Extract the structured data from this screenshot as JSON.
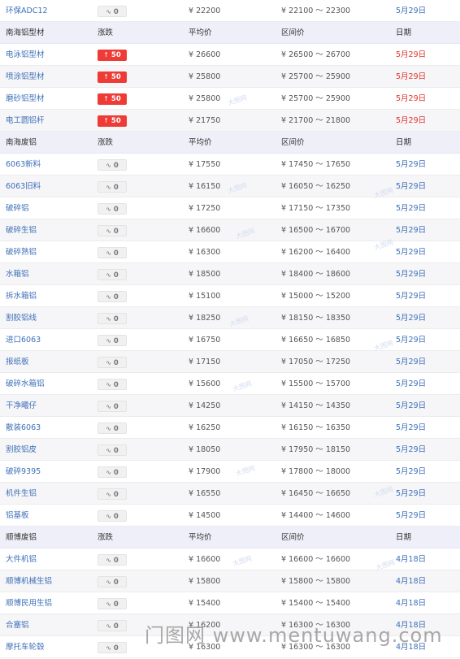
{
  "currency": "¥",
  "range_sep": "～",
  "header_labels": {
    "change": "涨跌",
    "avg": "平均价",
    "range": "区间价",
    "date": "日期"
  },
  "rows": [
    {
      "type": "item",
      "name": "环保ADC12",
      "sup": "",
      "change": "0",
      "dir": "flat",
      "avg": "22200",
      "low": "22100",
      "high": "22300",
      "date": "5月29日",
      "date_color": "blue"
    },
    {
      "type": "header",
      "name": "南海铝型材"
    },
    {
      "type": "item",
      "name": "电泳铝型材",
      "change": "50",
      "dir": "up",
      "avg": "26600",
      "low": "26500",
      "high": "26700",
      "date": "5月29日",
      "date_color": "red"
    },
    {
      "type": "item",
      "name": "喷涂铝型材",
      "change": "50",
      "dir": "up",
      "avg": "25800",
      "low": "25700",
      "high": "25900",
      "date": "5月29日",
      "date_color": "red"
    },
    {
      "type": "item",
      "name": "磨砂铝型材",
      "change": "50",
      "dir": "up",
      "avg": "25800",
      "low": "25700",
      "high": "25900",
      "date": "5月29日",
      "date_color": "red"
    },
    {
      "type": "item",
      "name": "电工圆铝杆",
      "change": "50",
      "dir": "up",
      "avg": "21750",
      "low": "21700",
      "high": "21800",
      "date": "5月29日",
      "date_color": "red"
    },
    {
      "type": "header",
      "name": "南海废铝"
    },
    {
      "type": "item",
      "name": "6063新料",
      "change": "0",
      "dir": "flat",
      "avg": "17550",
      "low": "17450",
      "high": "17650",
      "date": "5月29日",
      "date_color": "blue"
    },
    {
      "type": "item",
      "name": "6063旧料",
      "change": "0",
      "dir": "flat",
      "avg": "16150",
      "low": "16050",
      "high": "16250",
      "date": "5月29日",
      "date_color": "blue"
    },
    {
      "type": "item",
      "name": "破碎铝",
      "change": "0",
      "dir": "flat",
      "avg": "17250",
      "low": "17150",
      "high": "17350",
      "date": "5月29日",
      "date_color": "blue"
    },
    {
      "type": "item",
      "name": "破碎生铝",
      "change": "0",
      "dir": "flat",
      "avg": "16600",
      "low": "16500",
      "high": "16700",
      "date": "5月29日",
      "date_color": "blue"
    },
    {
      "type": "item",
      "name": "破碎熟铝",
      "change": "0",
      "dir": "flat",
      "avg": "16300",
      "low": "16200",
      "high": "16400",
      "date": "5月29日",
      "date_color": "blue"
    },
    {
      "type": "item",
      "name": "水箱铝",
      "change": "0",
      "dir": "flat",
      "avg": "18500",
      "low": "18400",
      "high": "18600",
      "date": "5月29日",
      "date_color": "blue"
    },
    {
      "type": "item",
      "name": "拆水箱铝",
      "change": "0",
      "dir": "flat",
      "avg": "15100",
      "low": "15000",
      "high": "15200",
      "date": "5月29日",
      "date_color": "blue"
    },
    {
      "type": "item",
      "name": "割胶铝线",
      "change": "0",
      "dir": "flat",
      "avg": "18250",
      "low": "18150",
      "high": "18350",
      "date": "5月29日",
      "date_color": "blue"
    },
    {
      "type": "item",
      "name": "进口6063",
      "change": "0",
      "dir": "flat",
      "avg": "16750",
      "low": "16650",
      "high": "16850",
      "date": "5月29日",
      "date_color": "blue"
    },
    {
      "type": "item",
      "name": "报纸板",
      "change": "0",
      "dir": "flat",
      "avg": "17150",
      "low": "17050",
      "high": "17250",
      "date": "5月29日",
      "date_color": "blue"
    },
    {
      "type": "item",
      "name": "破碎水箱铝",
      "change": "0",
      "dir": "flat",
      "avg": "15600",
      "low": "15500",
      "high": "15700",
      "date": "5月29日",
      "date_color": "blue"
    },
    {
      "type": "item",
      "name": "干净曦仔",
      "change": "0",
      "dir": "flat",
      "avg": "14250",
      "low": "14150",
      "high": "14350",
      "date": "5月29日",
      "date_color": "blue"
    },
    {
      "type": "item",
      "name": "散装6063",
      "change": "0",
      "dir": "flat",
      "avg": "16250",
      "low": "16150",
      "high": "16350",
      "date": "5月29日",
      "date_color": "blue"
    },
    {
      "type": "item",
      "name": "割胶铝皮",
      "change": "0",
      "dir": "flat",
      "avg": "18050",
      "low": "17950",
      "high": "18150",
      "date": "5月29日",
      "date_color": "blue"
    },
    {
      "type": "item",
      "name": "破碎9395",
      "change": "0",
      "dir": "flat",
      "avg": "17900",
      "low": "17800",
      "high": "18000",
      "date": "5月29日",
      "date_color": "blue"
    },
    {
      "type": "item",
      "name": "机件生铝",
      "change": "0",
      "dir": "flat",
      "avg": "16550",
      "low": "16450",
      "high": "16650",
      "date": "5月29日",
      "date_color": "blue"
    },
    {
      "type": "item",
      "name": "铝基板",
      "change": "0",
      "dir": "flat",
      "avg": "14500",
      "low": "14400",
      "high": "14600",
      "date": "5月29日",
      "date_color": "blue"
    },
    {
      "type": "header",
      "name": "顺博废铝"
    },
    {
      "type": "item",
      "name": "大件机铝",
      "change": "0",
      "dir": "flat",
      "avg": "16600",
      "low": "16600",
      "high": "16600",
      "date": "4月18日",
      "date_color": "blue"
    },
    {
      "type": "item",
      "name": "顺博机械生铝",
      "change": "0",
      "dir": "flat",
      "avg": "15800",
      "low": "15800",
      "high": "15800",
      "date": "4月18日",
      "date_color": "blue"
    },
    {
      "type": "item",
      "name": "顺博民用生铝",
      "change": "0",
      "dir": "flat",
      "avg": "15400",
      "low": "15400",
      "high": "15400",
      "date": "4月18日",
      "date_color": "blue"
    },
    {
      "type": "item",
      "name": "合塞铝",
      "change": "0",
      "dir": "flat",
      "avg": "16200",
      "low": "16300",
      "high": "16300",
      "date": "4月18日",
      "date_color": "blue"
    },
    {
      "type": "item",
      "name": "摩托车轮毂",
      "change": "0",
      "dir": "flat",
      "avg": "16300",
      "low": "16300",
      "high": "16300",
      "date": "4月18日",
      "date_color": "blue"
    }
  ],
  "watermark": {
    "text": "门图网 www.mentuwang.com",
    "mark": "大图网"
  }
}
